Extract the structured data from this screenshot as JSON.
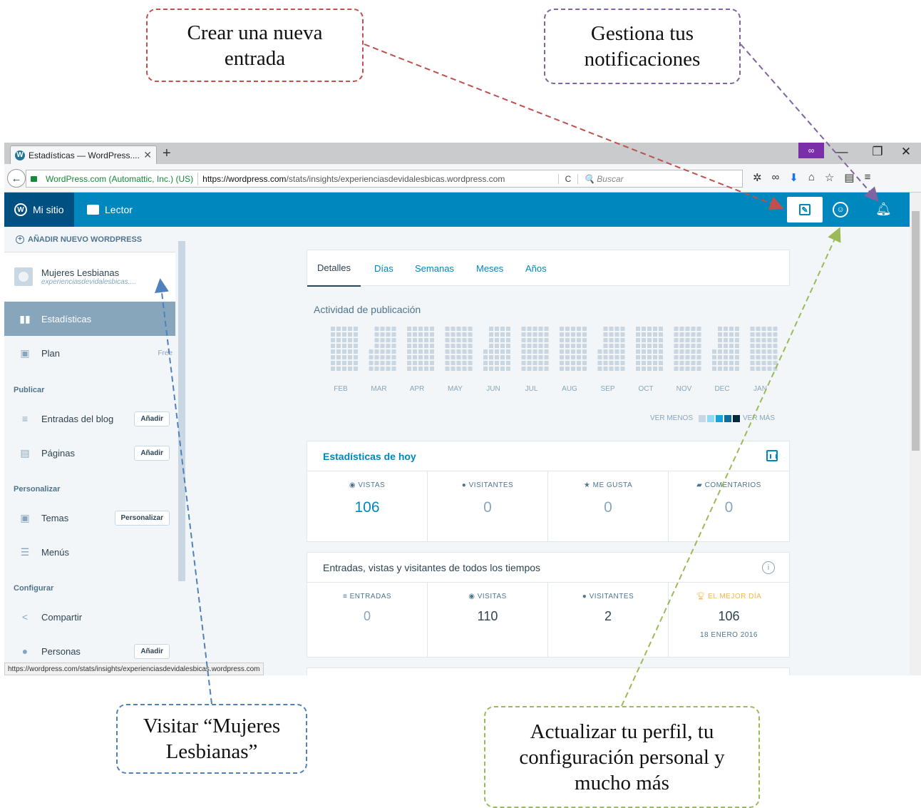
{
  "callouts": {
    "new_post": "Crear una nueva entrada",
    "notifications": "Gestiona tus notificaciones",
    "visit_site": "Visitar “Mujeres Lesbianas”",
    "profile": "Actualizar tu perfil, tu configuración personal y mucho más"
  },
  "browser": {
    "tab_title": "Estadísticas — WordPress....",
    "tab_close": "✕",
    "new_tab": "+",
    "identity": "WordPress.com (Automattic, Inc.) (US)",
    "url_host": "https://wordpress.com",
    "url_path": "/stats/insights/experienciasdevidalesbicas.wordpress.com",
    "reload": "C",
    "search_placeholder": "Buscar",
    "status_url": "https://wordpress.com/stats/insights/experienciasdevidalesbicas.wordpress.com"
  },
  "masterbar": {
    "my_site": "Mi sitio",
    "reader": "Lector"
  },
  "sidebar": {
    "add_new": "AÑADIR NUEVO WORDPRESS",
    "site_name": "Mujeres Lesbianas",
    "site_url": "experienciasdevidalesbicas....",
    "stats": "Estadísticas",
    "plan": "Plan",
    "plan_badge": "Free",
    "section_publish": "Publicar",
    "blog_posts": "Entradas del blog",
    "pages": "Páginas",
    "add": "Añadir",
    "section_personalize": "Personalizar",
    "themes": "Temas",
    "customize": "Personalizar",
    "menus": "Menús",
    "section_configure": "Configurar",
    "share": "Compartir",
    "people": "Personas"
  },
  "stats": {
    "tabs": [
      "Detalles",
      "Días",
      "Semanas",
      "Meses",
      "Años"
    ],
    "activity_title": "Actividad de publicación",
    "months": [
      "FEB",
      "MAR",
      "APR",
      "MAY",
      "JUN",
      "JUL",
      "AUG",
      "SEP",
      "OCT",
      "NOV",
      "DEC",
      "JAN"
    ],
    "legend_less": "VER MENOS",
    "legend_more": "VER MÁS",
    "legend_colors": [
      "#c8d7e1",
      "#92d9f5",
      "#16a3e0",
      "#0f6c9b",
      "#01283d"
    ],
    "today": {
      "title": "Estadísticas de hoy",
      "views_label": "VISTAS",
      "views": "106",
      "visitors_label": "VISITANTES",
      "visitors": "0",
      "likes_label": "ME GUSTA",
      "likes": "0",
      "comments_label": "COMENTARIOS",
      "comments": "0"
    },
    "alltime": {
      "title": "Entradas, vistas y visitantes de todos los tiempos",
      "posts_label": "ENTRADAS",
      "posts": "0",
      "visits_label": "VISITAS",
      "visits": "110",
      "visitors_label": "VISITANTES",
      "visitors": "2",
      "best_label": "EL MEJOR DÍA",
      "best": "106",
      "best_date": "18 ENERO 2016"
    }
  }
}
